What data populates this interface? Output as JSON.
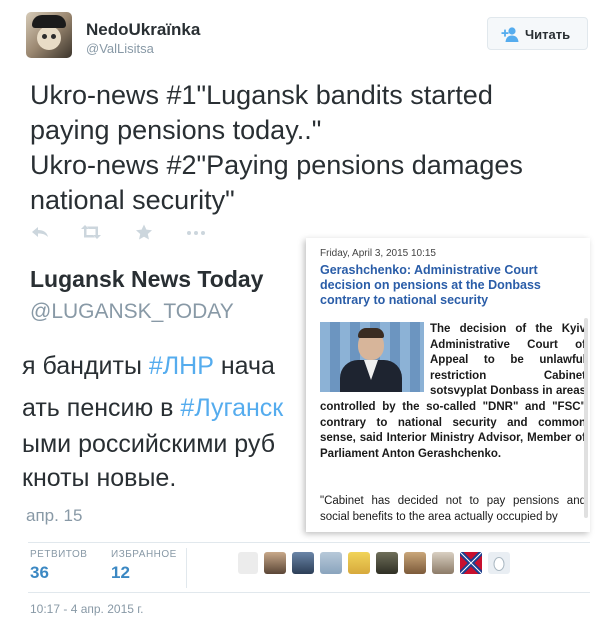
{
  "user": {
    "display_name": "NedoUkraïnka",
    "handle": "@ValLisitsa"
  },
  "follow_button": {
    "label": "Читать",
    "icon": "add-user-icon"
  },
  "tweet": {
    "lines": [
      "Ukro-news #1\"Lugansk bandits started",
      "paying pensions today..\"",
      "Ukro-news #2\"Paying pensions damages",
      "national security\""
    ]
  },
  "actions": [
    "reply-icon",
    "retweet-icon",
    "favorite-icon",
    "more-icon"
  ],
  "embedded_tweet": {
    "title": "Lugansk News Today",
    "handle": "@LUGANSK_TODAY",
    "line1_pre": "я бандиты ",
    "line1_tag": "#ЛНР",
    "line1_post": " нача",
    "line2_pre": "ать пенсию в ",
    "line2_tag": "#Луганск",
    "line3": "ыми российскими руб",
    "line4": "кноты новые.",
    "date": "апр. 15"
  },
  "article": {
    "date": "Friday, April 3, 2015 10:15",
    "title": "Gerashchenko: Administrative Court decision on pensions at the Donbass contrary to national security",
    "lead": "The decision of the Kyiv Administrative Court of Appeal to be unlawful restriction Cabinet sotsvyplat Donbass in areas controlled by the so-called \"DNR\" and \"FSC\" contrary to national security and common sense, said Interior Ministry Advisor, Member of Parliament Anton Gerashchenko.",
    "quote": "\"Cabinet has decided not to pay pensions and social benefits to the area actually occupied by"
  },
  "stats": {
    "retweets_label": "РЕТВИТОВ",
    "retweets_value": "36",
    "favorites_label": "ИЗБРАННОЕ",
    "favorites_value": "12"
  },
  "timestamp": "10:17 - 4 апр. 2015 г.",
  "colors": {
    "link": "#55acee",
    "stat_value": "#3b88c3",
    "article_title": "#2a5da8",
    "muted": "#8899a6"
  }
}
